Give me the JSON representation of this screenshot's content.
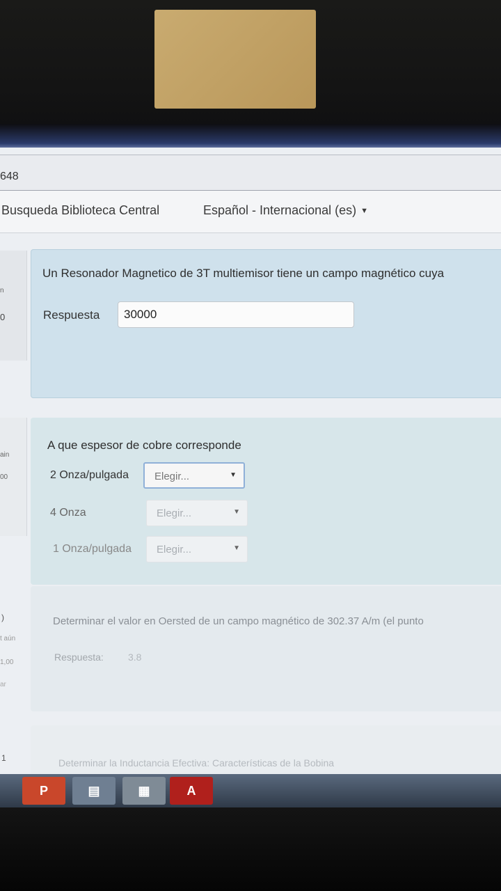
{
  "browser": {
    "url_fragment": "648"
  },
  "navbar": {
    "library_link": "Busqueda Biblioteca Central",
    "language_label": "Español - Internacional (es)"
  },
  "question1": {
    "text": "Un Resonador Magnetico de 3T multiemisor tiene un campo magnético cuya",
    "answer_label": "Respuesta",
    "answer_value": "30000"
  },
  "question2": {
    "text": "A que espesor de cobre corresponde",
    "rows": [
      {
        "label": "2 Onza/pulgada",
        "selected": "Elegir..."
      },
      {
        "label": "4 Onza",
        "selected": "Elegir..."
      },
      {
        "label": "1 Onza/pulgada",
        "selected": "Elegir..."
      }
    ]
  },
  "question3": {
    "text": "Determinar el valor en Oersted de un campo magnético de 302.37 A/m (el punto",
    "answer_label": "Respuesta:",
    "answer_value": "3.8"
  },
  "question4": {
    "number": "1",
    "text": "Determinar la Inductancia Efectiva: Características de la Bobina"
  },
  "side_labels": {
    "q1_a": "n",
    "q1_b": "0",
    "q2_a": "ain",
    "q2_b": "00",
    "q3_num": ")",
    "q3_a": "t aún",
    "q3_b": "1,00",
    "q3_c": "ar"
  },
  "taskbar": {
    "apps": [
      {
        "icon": "powerpoint-icon",
        "glyph": "P",
        "color": "#c9472b"
      },
      {
        "icon": "document-icon",
        "glyph": "▤",
        "color": "#6f7f92"
      },
      {
        "icon": "spreadsheet-icon",
        "glyph": "▦",
        "color": "#7f8b96"
      },
      {
        "icon": "pdf-icon",
        "glyph": "A",
        "color": "#b0201c"
      }
    ]
  }
}
